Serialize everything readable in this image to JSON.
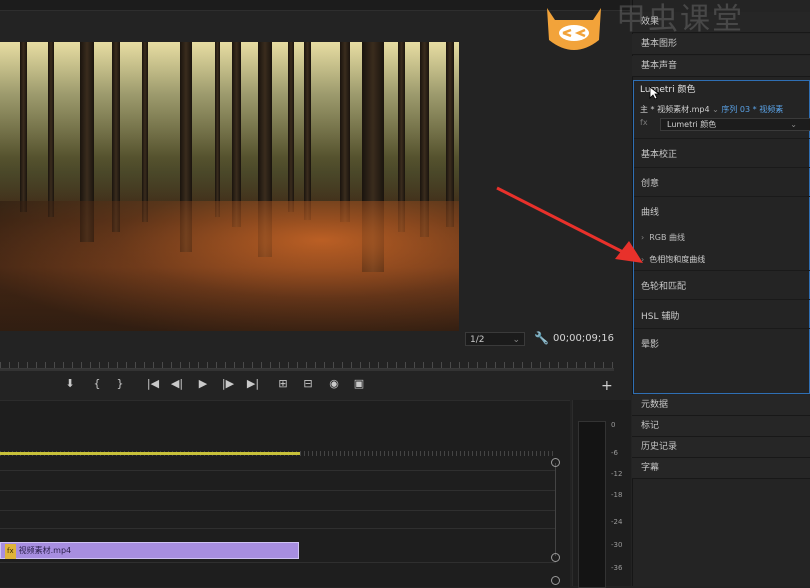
{
  "program_monitor": {
    "zoom_level": "1/2",
    "timecode": "00;00;09;16",
    "controls": [
      {
        "name": "add-marker-button",
        "glyph": "⬇"
      },
      {
        "name": "mark-in-button",
        "glyph": "{"
      },
      {
        "name": "mark-out-button",
        "glyph": "}"
      },
      {
        "name": "go-to-in-button",
        "glyph": "|◀"
      },
      {
        "name": "step-back-button",
        "glyph": "◀|"
      },
      {
        "name": "play-button",
        "glyph": "▶"
      },
      {
        "name": "step-forward-button",
        "glyph": "|▶"
      },
      {
        "name": "go-to-out-button",
        "glyph": "▶|"
      },
      {
        "name": "lift-button",
        "glyph": "⊞"
      },
      {
        "name": "extract-button",
        "glyph": "⊟"
      },
      {
        "name": "export-frame-button",
        "glyph": "◉"
      },
      {
        "name": "compare-view-button",
        "glyph": "▣"
      }
    ],
    "add_button": "+"
  },
  "timeline": {
    "clip_label": "视频素材.mp4",
    "clip_fx": "fx"
  },
  "audio_meter": {
    "labels": [
      "0",
      "-6",
      "-12",
      "-18",
      "-24",
      "-30",
      "-36"
    ]
  },
  "panel": {
    "tabs_top": [
      "效果",
      "基本图形",
      "基本声音"
    ],
    "lumetri_title": "Lumetri 颜色",
    "source_prefix": "主 * 视频素材.mp4",
    "sequence_label": "序列 03 * 视频素",
    "fx_label": "fx",
    "effect_name": "Lumetri 颜色",
    "sections": [
      {
        "label": "基本校正"
      },
      {
        "label": "创意"
      },
      {
        "label": "曲线"
      }
    ],
    "curve_subs": [
      "RGB 曲线",
      "色相饱和度曲线"
    ],
    "sections2": [
      "色轮和匹配",
      "HSL 辅助",
      "晕影"
    ],
    "tabs_bottom": [
      "元数据",
      "标记",
      "历史记录",
      "字幕"
    ]
  },
  "watermark": {
    "text": "甲虫课堂",
    "logo_color": "#f2a33a"
  }
}
